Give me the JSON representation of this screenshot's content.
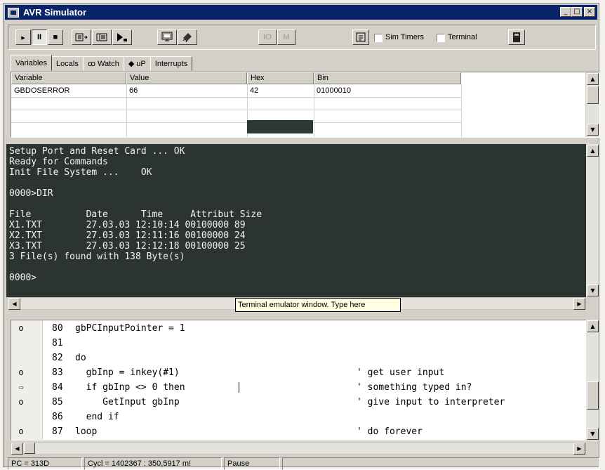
{
  "window": {
    "title": "AVR Simulator",
    "caption_min": "_",
    "caption_max": "□",
    "caption_close": "×"
  },
  "toolbar": {
    "run": "▸",
    "pause": "II",
    "stop": "■",
    "io": "IO",
    "m": "M",
    "sim_timers_label": "Sim Timers",
    "terminal_label": "Terminal"
  },
  "tabs": [
    {
      "label": "Variables"
    },
    {
      "label": "Locals"
    },
    {
      "label": "Watch",
      "icon": "binoculars-icon",
      "glyph": "ꝏ"
    },
    {
      "label": "uP",
      "icon": "chip-icon",
      "glyph": "◆"
    },
    {
      "label": "Interrupts"
    }
  ],
  "variables": {
    "headers": [
      "Variable",
      "Value",
      "Hex",
      "Bin"
    ],
    "rows": [
      [
        "GBDOSERROR",
        "66",
        "42",
        "01000010"
      ]
    ]
  },
  "terminal": {
    "lines": [
      "Setup Port and Reset Card ... OK",
      "Ready for Commands",
      "Init File System ...    OK",
      "",
      "0000>DIR",
      "",
      "File          Date      Time     Attribut Size",
      "X1.TXT        27.03.03 12:10:14 00100000 89",
      "X2.TXT        27.03.03 12:11:16 00100000 24",
      "X3.TXT        27.03.03 12:12:18 00100000 25",
      "3 File(s) found with 138 Byte(s)",
      "",
      "0000>"
    ],
    "tooltip": "Terminal emulator window. Type here"
  },
  "code": {
    "lines": [
      {
        "mark": "o",
        "num": "80",
        "src": "gbPCInputPointer = 1",
        "comment": ""
      },
      {
        "mark": "",
        "num": "81",
        "src": "",
        "comment": ""
      },
      {
        "mark": "",
        "num": "82",
        "src": "do",
        "comment": ""
      },
      {
        "mark": "o",
        "num": "83",
        "src": "  gbInp = inkey(#1)",
        "comment": "' get user input"
      },
      {
        "mark": "⇨",
        "num": "84",
        "src": "  if gbInp <> 0 then",
        "comment": "' something typed in?"
      },
      {
        "mark": "o",
        "num": "85",
        "src": "     GetInput gbInp",
        "comment": "' give input to interpreter"
      },
      {
        "mark": "",
        "num": "86",
        "src": "  end if",
        "comment": ""
      },
      {
        "mark": "o",
        "num": "87",
        "src": "loop",
        "comment": "' do forever"
      }
    ]
  },
  "status": {
    "pc": "PC = 313D",
    "cycles": "Cycl = 1402367 : 350,5917 m!",
    "state": "Pause"
  }
}
